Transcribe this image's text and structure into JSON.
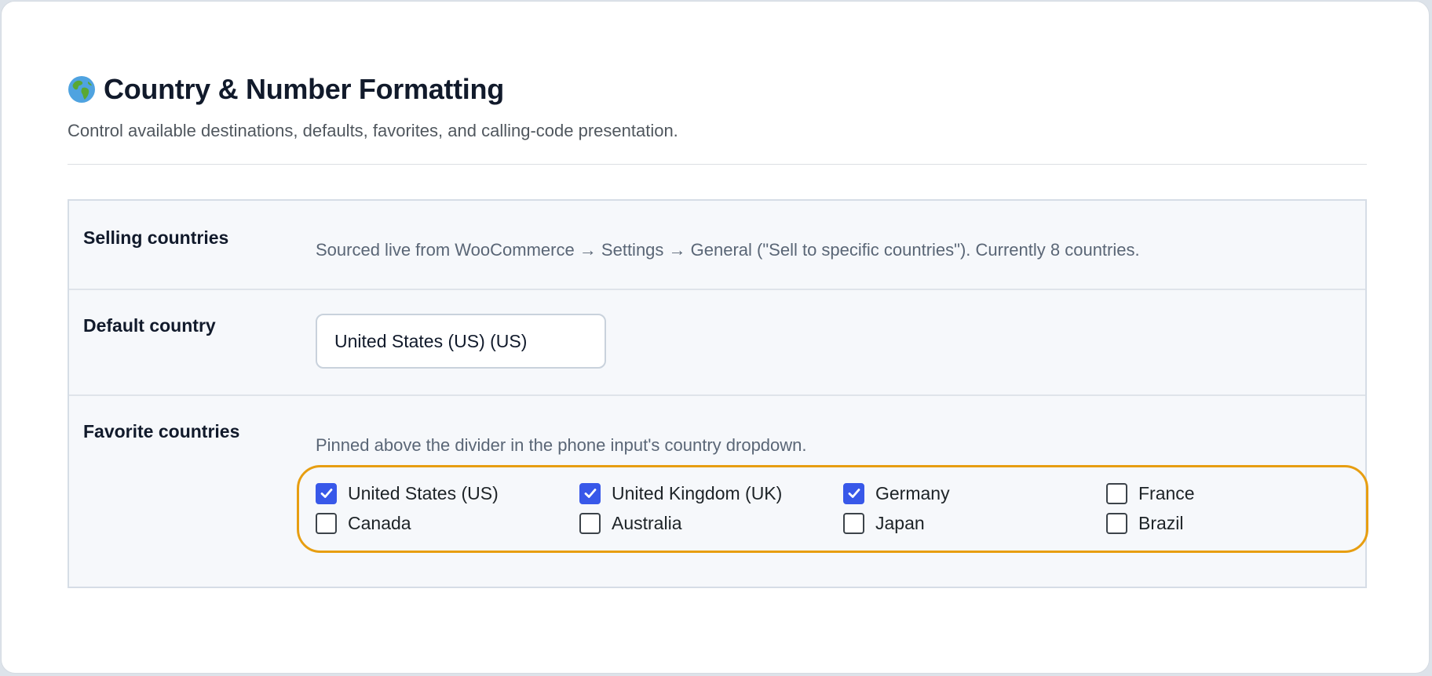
{
  "header": {
    "title": "Country & Number Formatting",
    "subtitle": "Control available destinations, defaults, favorites, and calling-code presentation.",
    "icon": "globe-icon"
  },
  "settings": {
    "selling_countries": {
      "label": "Selling countries",
      "description": "Sourced live from WooCommerce → Settings → General (\"Sell to specific countries\"). Currently 8 countries."
    },
    "default_country": {
      "label": "Default country",
      "value": "United States (US) (US)"
    },
    "favorite_countries": {
      "label": "Favorite countries",
      "description": "Pinned above the divider in the phone input's country dropdown.",
      "options": [
        {
          "label": "United States (US)",
          "checked": true
        },
        {
          "label": "United Kingdom (UK)",
          "checked": true
        },
        {
          "label": "Germany",
          "checked": true
        },
        {
          "label": "France",
          "checked": false
        },
        {
          "label": "Canada",
          "checked": false
        },
        {
          "label": "Australia",
          "checked": false
        },
        {
          "label": "Japan",
          "checked": false
        },
        {
          "label": "Brazil",
          "checked": false
        }
      ]
    }
  },
  "colors": {
    "checkbox_checked": "#3858e9",
    "highlight": "#e79e11"
  }
}
